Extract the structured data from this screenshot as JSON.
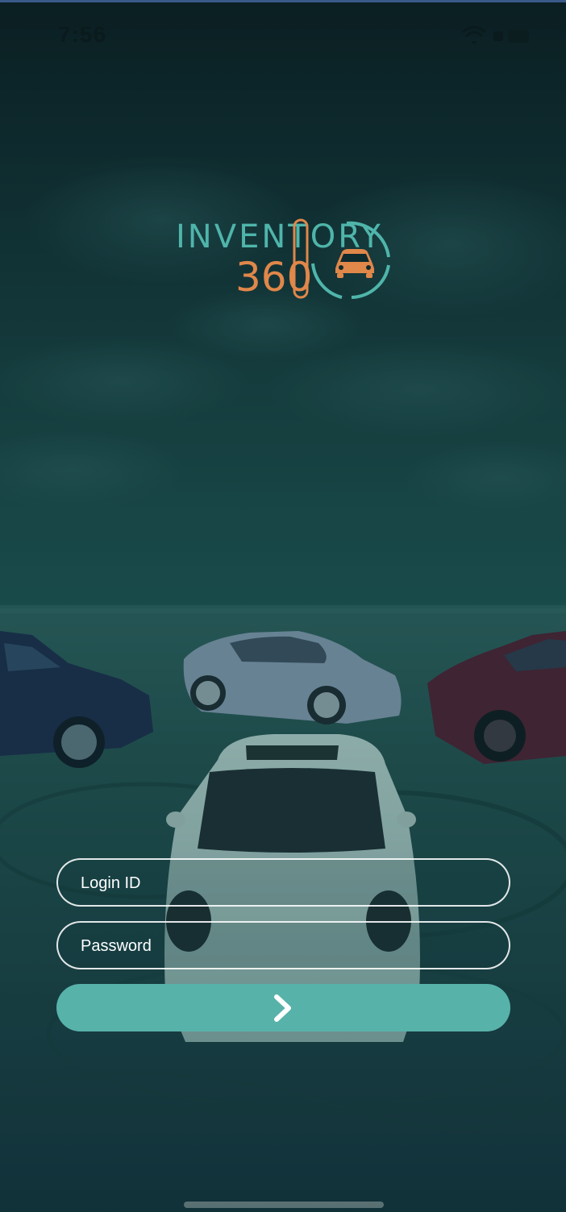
{
  "status_bar": {
    "time": "7:56",
    "icons": [
      "wifi-icon",
      "battery-icon"
    ]
  },
  "logo": {
    "line1": "INVENTORY",
    "line2": "360",
    "colors": {
      "teal": "#4fb5ab",
      "orange": "#e0874a"
    }
  },
  "login_form": {
    "login_id_placeholder": "Login ID",
    "password_placeholder": "Password",
    "submit_icon": "chevron-right-icon"
  },
  "theme": {
    "accent": "#57b2aa",
    "field_border": "#ffffff",
    "overlay_tint": "#1b4a4a"
  }
}
